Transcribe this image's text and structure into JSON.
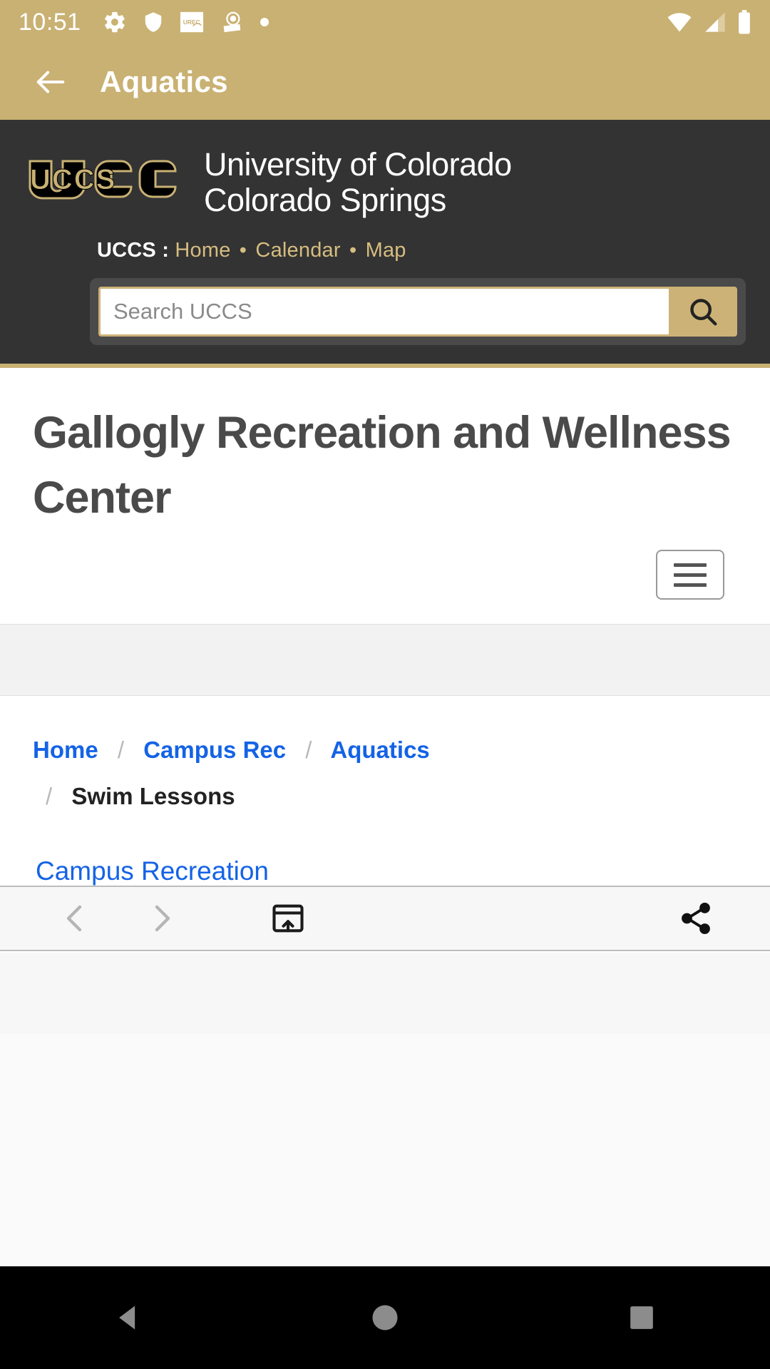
{
  "status_bar": {
    "clock": "10:51",
    "left_icons": [
      "gear-icon",
      "shield-icon",
      "urec-app-icon",
      "badge-app-icon",
      "dot-indicator-icon"
    ],
    "right_icons": [
      "wifi-icon",
      "cell-signal-icon",
      "battery-icon"
    ],
    "urec_icon_label": "UREC"
  },
  "app_bar": {
    "back_icon": "arrow-left-icon",
    "title": "Aquatics",
    "background": "#c9b173"
  },
  "site_header": {
    "logo_text": "UCCS",
    "brand_line1": "University of Colorado",
    "brand_line2": "Colorado Springs",
    "util_nav_label": "UCCS :",
    "util_nav_items": [
      {
        "label": "Home"
      },
      {
        "label": "Calendar"
      },
      {
        "label": "Map"
      }
    ],
    "separator": "•",
    "search": {
      "placeholder": "Search UCCS",
      "value": "",
      "button_icon": "search-icon"
    },
    "background": "#333333",
    "accent": "#c9b173"
  },
  "main": {
    "page_title": "Gallogly Recreation and Wellness Center",
    "menu_toggle_icon": "hamburger-menu-icon",
    "breadcrumb": [
      {
        "label": "Home",
        "link": true
      },
      {
        "label": "Campus Rec",
        "link": true
      },
      {
        "label": "Aquatics",
        "link": true
      },
      {
        "label": "Swim Lessons",
        "link": false
      }
    ],
    "breadcrumb_separator": "/",
    "section_link": "Campus Recreation",
    "link_color": "#1463e6"
  },
  "browser_toolbar": {
    "buttons": [
      {
        "name": "back",
        "icon": "chevron-left-icon",
        "enabled": false
      },
      {
        "name": "forward",
        "icon": "chevron-right-icon",
        "enabled": false
      },
      {
        "name": "tabs",
        "icon": "open-in-browser-icon",
        "enabled": true
      },
      {
        "name": "share",
        "icon": "share-icon",
        "enabled": true
      }
    ]
  },
  "nav_bar": {
    "buttons": [
      {
        "name": "back",
        "icon": "triangle-back-icon"
      },
      {
        "name": "home",
        "icon": "circle-home-icon"
      },
      {
        "name": "recents",
        "icon": "square-recents-icon"
      }
    ]
  }
}
